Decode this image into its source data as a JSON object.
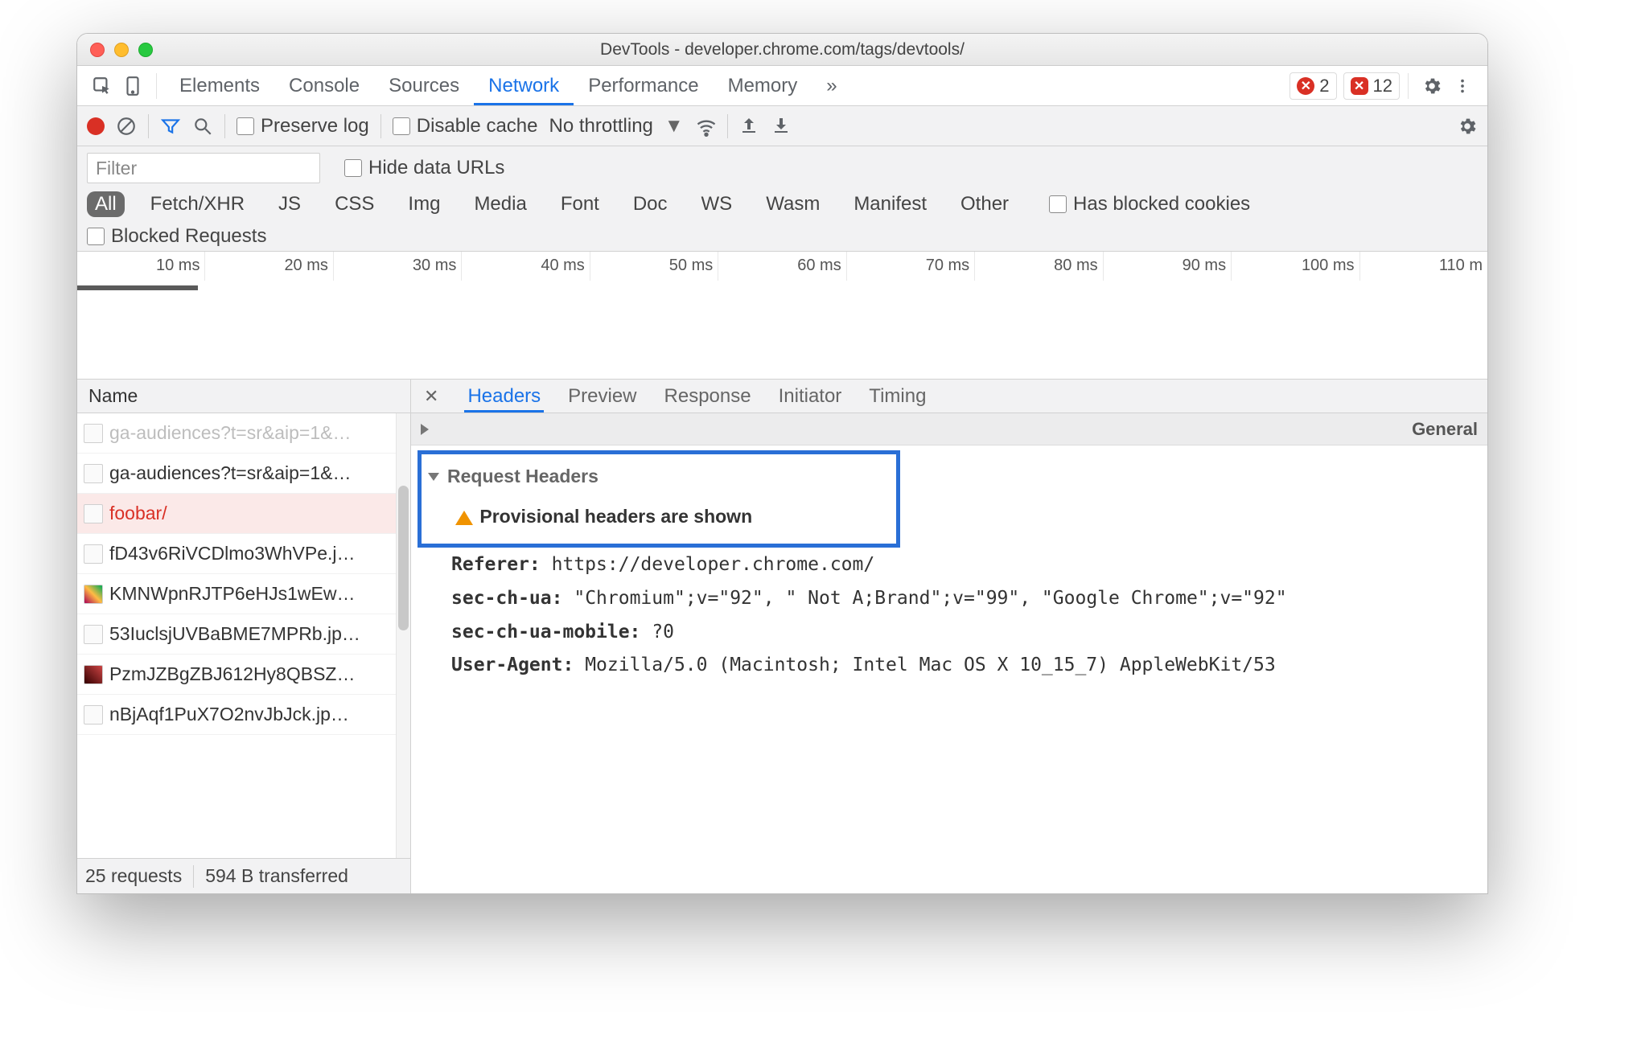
{
  "window": {
    "title": "DevTools - developer.chrome.com/tags/devtools/"
  },
  "topTabs": {
    "items": [
      "Elements",
      "Console",
      "Sources",
      "Network",
      "Performance",
      "Memory"
    ],
    "activeIndex": 3,
    "more": "»",
    "errorsCircle": "2",
    "errorsSquare": "12"
  },
  "netToolbar": {
    "preserveLog": "Preserve log",
    "disableCache": "Disable cache",
    "throttling": "No throttling"
  },
  "filter": {
    "placeholder": "Filter",
    "hideDataUrls": "Hide data URLs",
    "types": [
      "All",
      "Fetch/XHR",
      "JS",
      "CSS",
      "Img",
      "Media",
      "Font",
      "Doc",
      "WS",
      "Wasm",
      "Manifest",
      "Other"
    ],
    "hasBlockedCookies": "Has blocked cookies",
    "blockedRequests": "Blocked Requests"
  },
  "timeline": {
    "ticks": [
      "10 ms",
      "20 ms",
      "30 ms",
      "40 ms",
      "50 ms",
      "60 ms",
      "70 ms",
      "80 ms",
      "90 ms",
      "100 ms",
      "110 m"
    ]
  },
  "requestList": {
    "header": "Name",
    "rows": [
      {
        "name": "ga-audiences?t=sr&aip=1&…",
        "dim": true
      },
      {
        "name": "ga-audiences?t=sr&aip=1&…"
      },
      {
        "name": "foobar/",
        "selected": true
      },
      {
        "name": "fD43v6RiVCDlmo3WhVPe.j…"
      },
      {
        "name": "KMNWpnRJTP6eHJs1wEw…"
      },
      {
        "name": "53IuclsjUVBaBME7MPRb.jp…"
      },
      {
        "name": "PzmJZBgZBJ612Hy8QBSZ…"
      },
      {
        "name": "nBjAqf1PuX7O2nvJbJck.jp…"
      }
    ],
    "status": {
      "requests": "25 requests",
      "transferred": "594 B transferred"
    }
  },
  "detail": {
    "tabs": [
      "Headers",
      "Preview",
      "Response",
      "Initiator",
      "Timing"
    ],
    "activeTab": 0,
    "generalLabel": "General",
    "reqHeadersLabel": "Request Headers",
    "provisional": "Provisional headers are shown",
    "headers": {
      "referer_k": "Referer:",
      "referer_v": "https://developer.chrome.com/",
      "secua_k": "sec-ch-ua:",
      "secua_v": "\"Chromium\";v=\"92\", \" Not A;Brand\";v=\"99\", \"Google Chrome\";v=\"92\"",
      "secmob_k": "sec-ch-ua-mobile:",
      "secmob_v": "?0",
      "ua_k": "User-Agent:",
      "ua_v": "Mozilla/5.0 (Macintosh; Intel Mac OS X 10_15_7) AppleWebKit/53"
    }
  }
}
